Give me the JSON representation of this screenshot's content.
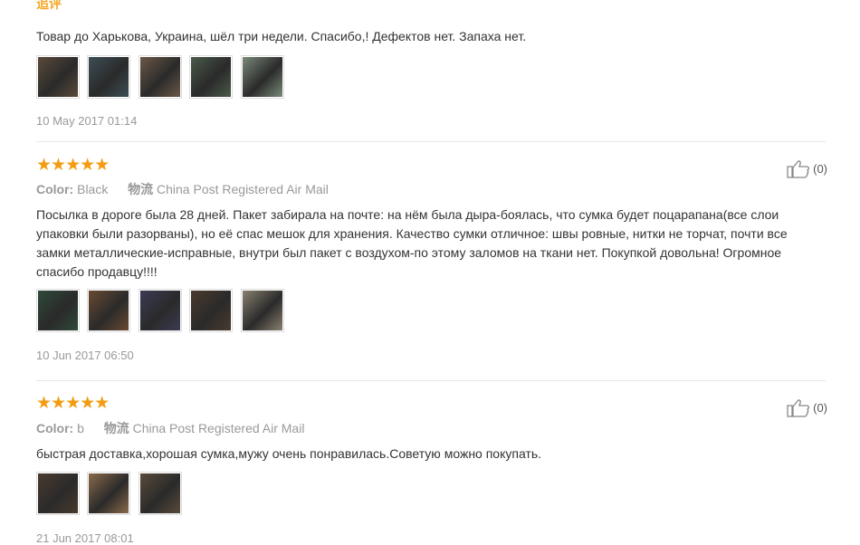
{
  "reviews": [
    {
      "additional_label": "追评",
      "text": "Товар до Харькова, Украина, шёл три недели. Спасибо,! Дефектов нет. Запаха нет.",
      "photos": [
        "#5a4a3a",
        "#3d4e55",
        "#6b5846",
        "#4a5a4a",
        "#7a8a7a"
      ],
      "date": "10 May 2017 01:14"
    },
    {
      "stars": "★★★★★",
      "color_label": "Color:",
      "color_value": "Black",
      "shipping_label": "物流",
      "shipping_value": "China Post Registered Air Mail",
      "likes": "(0)",
      "text": "Посылка в дороге была 28 дней. Пакет забирала на почте: на нём была дыра-боялась, что сумка будет поцарапана(все слои упаковки были разорваны), но её спас мешок для хранения. Качество сумки отличное: швы ровные, нитки не торчат, почти все замки металлические-исправные, внутри был пакет с воздухом-по этому заломов на ткани нет. Покупкой довольна! Огромное спасибо продавцу!!!!",
      "photos": [
        "#2f4a3a",
        "#6a4a32",
        "#3b3b55",
        "#4a3a2e",
        "#8a8070"
      ],
      "date": "10 Jun 2017 06:50"
    },
    {
      "stars": "★★★★★",
      "color_label": "Color:",
      "color_value": "b",
      "shipping_label": "物流",
      "shipping_value": "China Post Registered Air Mail",
      "likes": "(0)",
      "text": "быстрая доставка,хорошая сумка,мужу очень понравилась.Советую можно покупать.",
      "photos": [
        "#4a3a2e",
        "#8a6a4a",
        "#5a4a3a"
      ],
      "date": "21 Jun 2017 08:01"
    }
  ],
  "colors": {
    "stars": "#f39c12",
    "additional_label": "#f5a623",
    "meta": "#999999",
    "text": "#333333"
  }
}
